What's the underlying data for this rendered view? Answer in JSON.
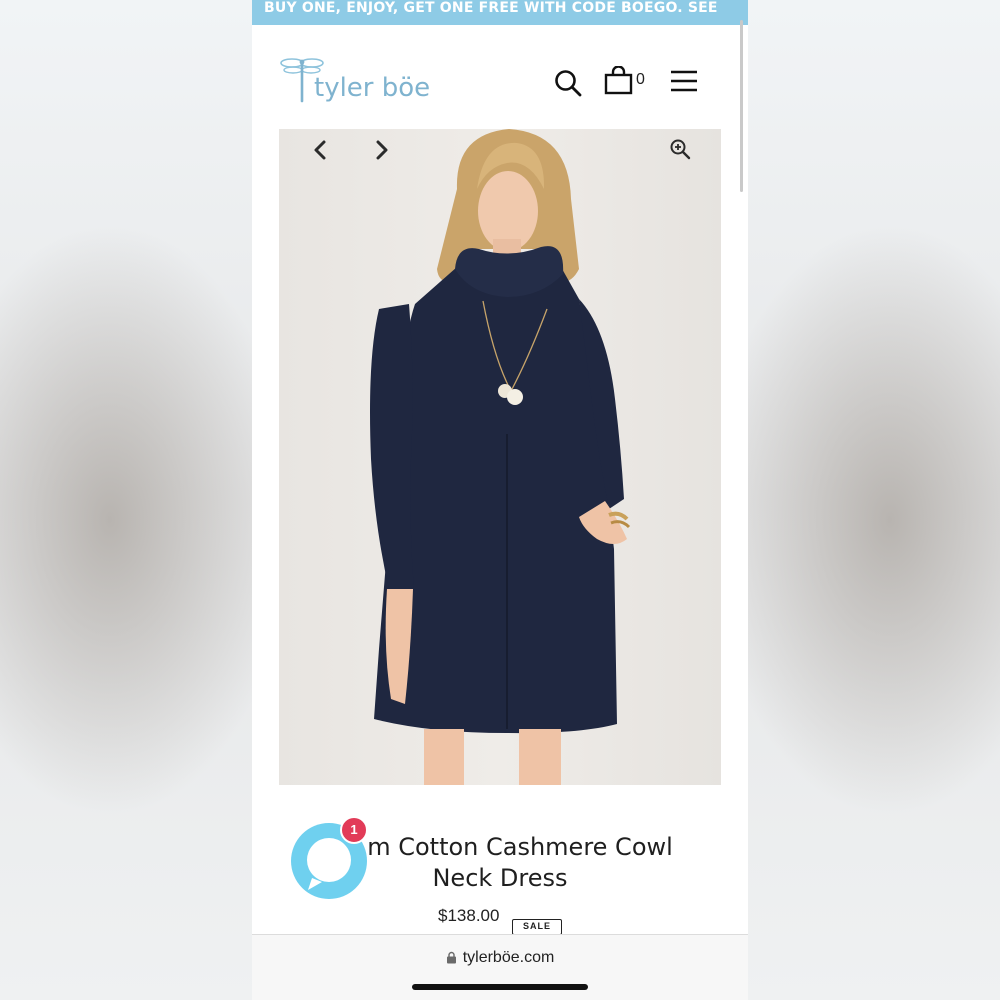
{
  "promo": {
    "text": "BUY ONE, ENJOY, GET ONE FREE WITH CODE BOEGO. SEE"
  },
  "header": {
    "logo_text": "tyler böe",
    "cart_count": "0",
    "icons": [
      "search-icon",
      "shopping-bag-icon",
      "menu-icon"
    ]
  },
  "gallery": {
    "icons": [
      "chevron-left-icon",
      "chevron-right-icon",
      "zoom-in-icon"
    ]
  },
  "product": {
    "title_line1": "m Cotton Cashmere Cowl",
    "title_line2": "Neck Dress",
    "price": "$138.00",
    "badge": "SALE"
  },
  "chat": {
    "badge_count": "1"
  },
  "browser": {
    "url": "tylerböe.com"
  },
  "colors": {
    "promo_bg": "#8ecbe6",
    "logo": "#7fb3cf",
    "chat_ring": "#6fd0ef",
    "badge": "#e23b58",
    "dress": "#1f2740"
  }
}
